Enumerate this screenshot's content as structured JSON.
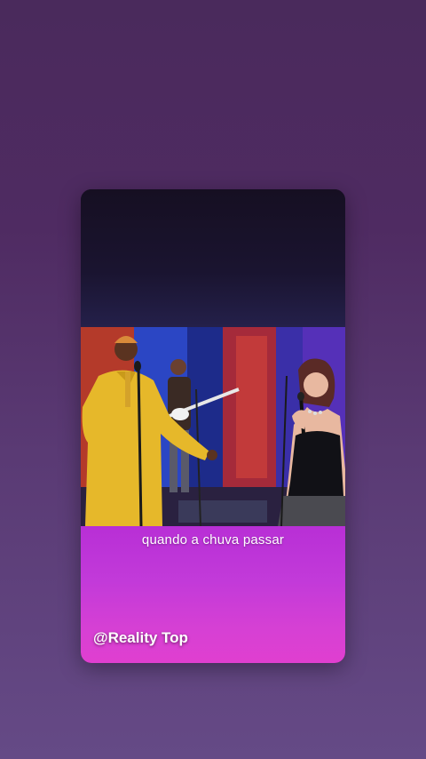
{
  "video": {
    "subtitle": "quando a chuva passar",
    "watermark": "@Reality Top"
  },
  "colors": {
    "background_top": "#4a2a5c",
    "background_bottom": "#654a86",
    "caption_panel": "#c23ad9",
    "subtitle_text": "#ffffff"
  }
}
